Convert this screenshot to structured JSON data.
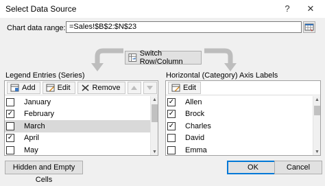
{
  "window": {
    "title": "Select Data Source",
    "help_label": "?",
    "close_label": "✕"
  },
  "range": {
    "label": "Chart data range:",
    "value": "=Sales!$B$2:$N$23"
  },
  "switch_label": "Switch Row/Column",
  "legend": {
    "heading": "Legend Entries (Series)",
    "add_label": "Add",
    "edit_label": "Edit",
    "remove_label": "Remove",
    "items": [
      {
        "label": "January",
        "checked": false,
        "selected": false
      },
      {
        "label": "February",
        "checked": true,
        "selected": false
      },
      {
        "label": "March",
        "checked": false,
        "selected": true
      },
      {
        "label": "April",
        "checked": true,
        "selected": false
      },
      {
        "label": "May",
        "checked": false,
        "selected": false
      }
    ]
  },
  "axis": {
    "heading": "Horizontal (Category) Axis Labels",
    "edit_label": "Edit",
    "items": [
      {
        "label": "Allen",
        "checked": true
      },
      {
        "label": "Brock",
        "checked": true
      },
      {
        "label": "Charles",
        "checked": true
      },
      {
        "label": "David",
        "checked": false
      },
      {
        "label": "Emma",
        "checked": false
      }
    ]
  },
  "footer": {
    "hidden_label": "Hidden and Empty Cells",
    "ok_label": "OK",
    "cancel_label": "Cancel"
  },
  "colors": {
    "primary_border": "#0078d7",
    "selected_row": "#d9d9d9",
    "background": "#f0f0f0"
  }
}
